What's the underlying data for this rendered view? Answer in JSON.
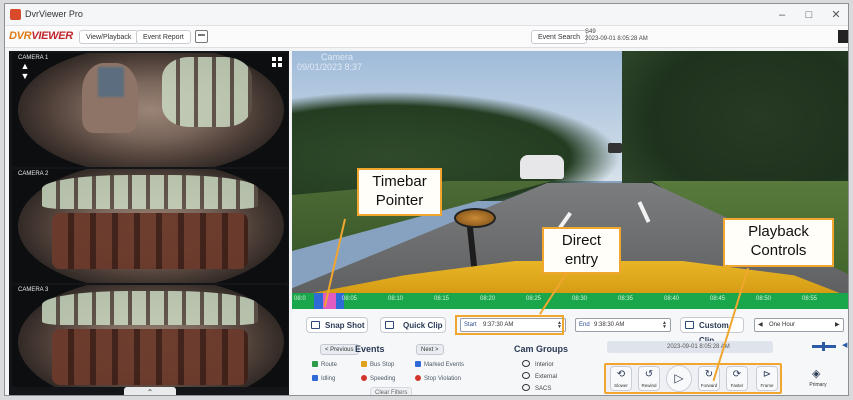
{
  "window": {
    "title": "DvrViewer Pro",
    "minimize": "–",
    "maximize": "□",
    "close": "✕"
  },
  "toolbar": {
    "logo_a": "DVR",
    "logo_b": "VIEWER",
    "view_playback": "View/Playback",
    "event_report": "Event Report",
    "event_search": "Event Search",
    "sw_label": "S49",
    "sw_date": "2023-09-01 8:05:28 AM"
  },
  "cameras": [
    {
      "label": "CAMERA 1",
      "type": "interior-driver"
    },
    {
      "label": "CAMERA 2",
      "type": "interior-seats"
    },
    {
      "label": "CAMERA 3",
      "type": "interior-seats"
    }
  ],
  "main_video": {
    "osd_line1": "Camera",
    "osd_line2": "09/01/2023 8:37"
  },
  "timebar": {
    "ticks": [
      "08:0",
      "08:05",
      "08:10",
      "08:15",
      "08:20",
      "08:25",
      "08:30",
      "08:35",
      "08:40",
      "08:45",
      "08:50",
      "08:55"
    ],
    "colors": {
      "record": "#1aa64a",
      "marked": "#2f6bd6",
      "event": "#e05cc0"
    }
  },
  "controls": {
    "snapshot": "Snap Shot",
    "quick_clip": "Quick Clip",
    "start_label": "Start",
    "start_value": "9:37:30 AM",
    "end_label": "End",
    "end_value": "9:38:30 AM",
    "custom_clip": "Custom Clip",
    "range_value": "One Hour",
    "previous": "< Previous",
    "next": "Next >",
    "events_title": "Events",
    "events": [
      {
        "label": "Route",
        "color": "#2e9b4a"
      },
      {
        "label": "Bus Stop",
        "color": "#e0a21b"
      },
      {
        "label": "Marked Events",
        "color": "#2f6bd6"
      },
      {
        "label": "Idling",
        "color": "#2f6bd6"
      },
      {
        "label": "Speeding",
        "color": "#d2352c"
      },
      {
        "label": "Stop Violation",
        "color": "#d2352c"
      }
    ],
    "clear_filters": "Clear Filters",
    "cam_groups_title": "Cam Groups",
    "cam_groups": [
      "Interior",
      "External",
      "SACS"
    ],
    "date_field": "2023-09-01 8:05:28 AM",
    "playback": [
      {
        "label": "Slower",
        "icon": "slower-icon",
        "glyph": "⟲"
      },
      {
        "label": "Rewind",
        "icon": "rewind-icon",
        "glyph": "↺"
      },
      {
        "label": "",
        "icon": "play-icon",
        "glyph": "▷"
      },
      {
        "label": "Forward",
        "icon": "forward-icon",
        "glyph": "↻"
      },
      {
        "label": "Faster",
        "icon": "faster-icon",
        "glyph": "⟳"
      },
      {
        "label": "Frame",
        "icon": "frame-icon",
        "glyph": "⊳"
      }
    ],
    "primary": "Primary"
  },
  "callouts": {
    "timebar": "Timebar\nPointer",
    "direct": "Direct\nentry",
    "playback": "Playback\nControls"
  },
  "accent": "#f0a62f"
}
